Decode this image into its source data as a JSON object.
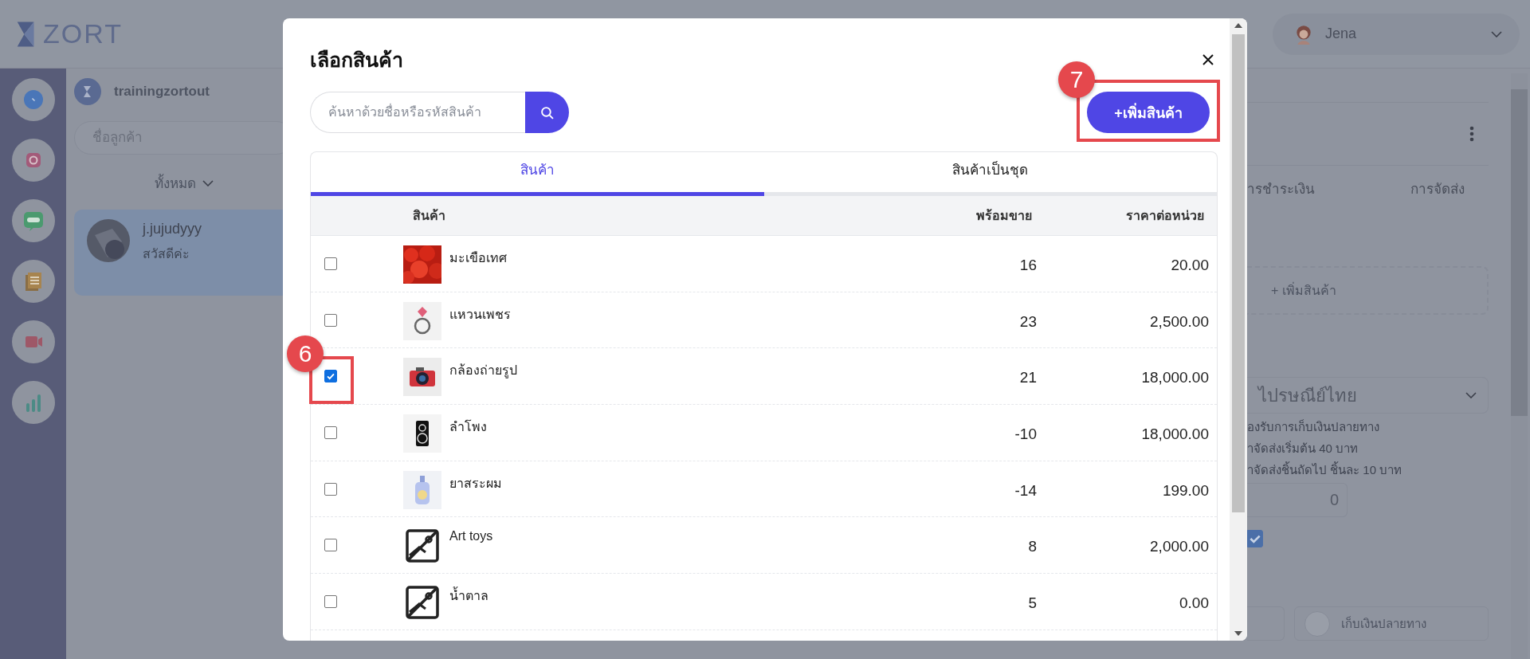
{
  "app": {
    "logo": "ZORT",
    "shop": "trainingzortout",
    "customer_search": {
      "placeholder": "ชื่อลูกค้า"
    },
    "filter": "ทั้งหมด",
    "channels": [
      {
        "kind": "messenger"
      },
      {
        "kind": "instagram"
      },
      {
        "kind": "line"
      },
      {
        "kind": "notes"
      },
      {
        "kind": "video"
      },
      {
        "kind": "stats"
      }
    ],
    "chats": [
      {
        "name": "j.jujudyyy",
        "preview": "สวัสดีค่ะ",
        "selected": true
      }
    ]
  },
  "user": {
    "name": "Jena"
  },
  "order_panel": {
    "tabs": [
      {
        "label": "ารชำระเงิน"
      },
      {
        "label": "การจัดส่ง"
      }
    ],
    "add_product": "+ เพิ่มสินค้า",
    "shipping_select": "ไปรษณีย์ไทย",
    "notes": [
      "องรับการเก็บเงินปลายทาง",
      "าจัดส่งเริ่มต้น 40 บาท",
      "าจัดส่งชิ้นถัดไป ชิ้นละ 10 บาท"
    ],
    "quantity": "0",
    "confirm_checked": true,
    "payment_option": {
      "label": "เก็บเงินปลายทาง",
      "selected": false
    }
  },
  "modal": {
    "title": "เลือกสินค้า",
    "search": {
      "placeholder": "ค้นหาด้วยชื่อหรือรหัสสินค้า"
    },
    "add_button": "+เพิ่มสินค้า",
    "add_callout": "7",
    "tabs": [
      {
        "label": "สินค้า",
        "selected": true
      },
      {
        "label": "สินค้าเป็นชุด",
        "selected": false
      }
    ],
    "table": {
      "columns": [
        "สินค้า",
        "พร้อมขาย",
        "ราคาต่อหน่วย"
      ],
      "rows": [
        {
          "checked": false,
          "name": "มะเขือเทศ",
          "available": "16",
          "price": "20.00"
        },
        {
          "checked": false,
          "name": "แหวนเพชร",
          "available": "23",
          "price": "2,500.00"
        },
        {
          "checked": true,
          "name": "กล้องถ่ายรูป",
          "available": "21",
          "price": "18,000.00",
          "callout": "6"
        },
        {
          "checked": false,
          "name": "ลำโพง",
          "available": "-10",
          "price": "18,000.00"
        },
        {
          "checked": false,
          "name": "ยาสระผม",
          "available": "-14",
          "price": "199.00"
        },
        {
          "checked": false,
          "kind": "no_image",
          "name": "Art toys",
          "available": "8",
          "price": "2,000.00"
        },
        {
          "checked": false,
          "kind": "no_image",
          "name": "น้ำตาล",
          "available": "5",
          "price": "0.00"
        }
      ]
    }
  }
}
